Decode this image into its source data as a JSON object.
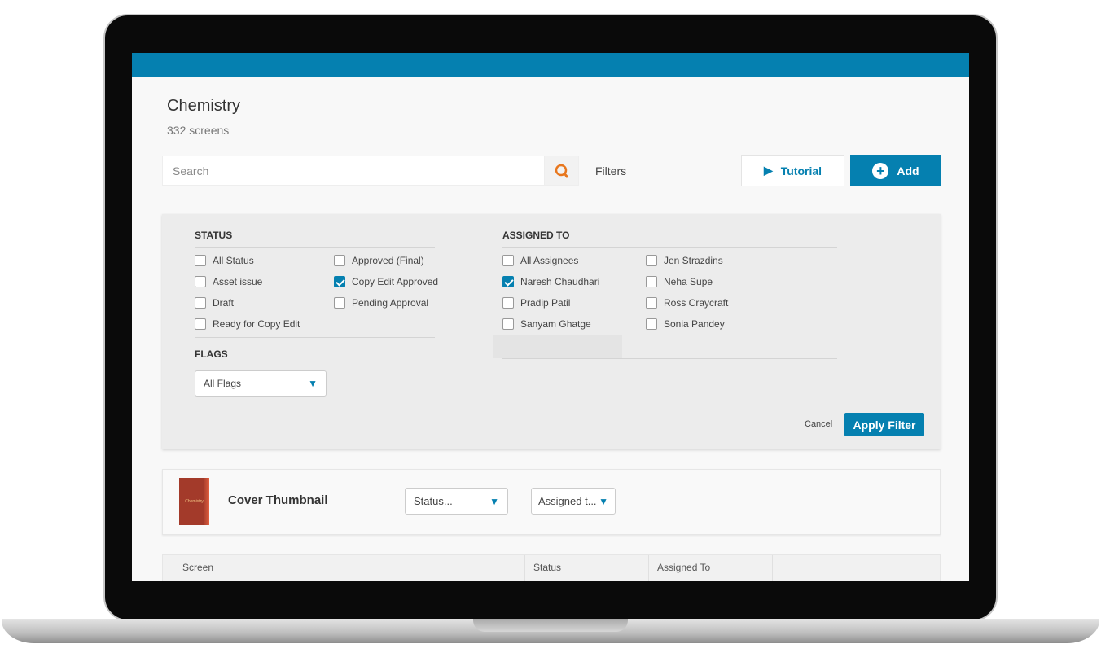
{
  "header": {
    "title": "Chemistry",
    "subtitle": "332 screens",
    "accent": "#0580b0"
  },
  "toolbar": {
    "search_placeholder": "Search",
    "search_icon": "search-icon",
    "filters_label": "Filters",
    "tutorial_label": "Tutorial",
    "add_label": "Add"
  },
  "filter_panel": {
    "status_heading": "STATUS",
    "status": [
      {
        "label": "All Status",
        "checked": false
      },
      {
        "label": "Asset issue",
        "checked": false
      },
      {
        "label": "Draft",
        "checked": false
      },
      {
        "label": "Ready for Copy Edit",
        "checked": false
      },
      {
        "label": "Approved (Final)",
        "checked": false
      },
      {
        "label": "Copy Edit Approved",
        "checked": true
      },
      {
        "label": "Pending Approval",
        "checked": false
      }
    ],
    "flags_heading": "FLAGS",
    "flags_value": "All Flags",
    "assigned_heading": "ASSIGNED TO",
    "assignees": [
      {
        "label": "All Assignees",
        "checked": false
      },
      {
        "label": "Naresh Chaudhari",
        "checked": true
      },
      {
        "label": "Pradip Patil",
        "checked": false
      },
      {
        "label": "Sanyam Ghatge",
        "checked": false
      },
      {
        "label": "Jen Strazdins",
        "checked": false
      },
      {
        "label": "Neha Supe",
        "checked": false
      },
      {
        "label": "Ross Craycraft",
        "checked": false
      },
      {
        "label": "Sonia Pandey",
        "checked": false
      }
    ],
    "cancel_label": "Cancel",
    "apply_label": "Apply Filter"
  },
  "cover": {
    "thumb_text": "Chemistry",
    "title": "Cover Thumbnail",
    "status_placeholder": "Status...",
    "assigned_placeholder": "Assigned t..."
  },
  "table": {
    "columns": [
      "Screen",
      "Status",
      "Assigned To"
    ]
  }
}
